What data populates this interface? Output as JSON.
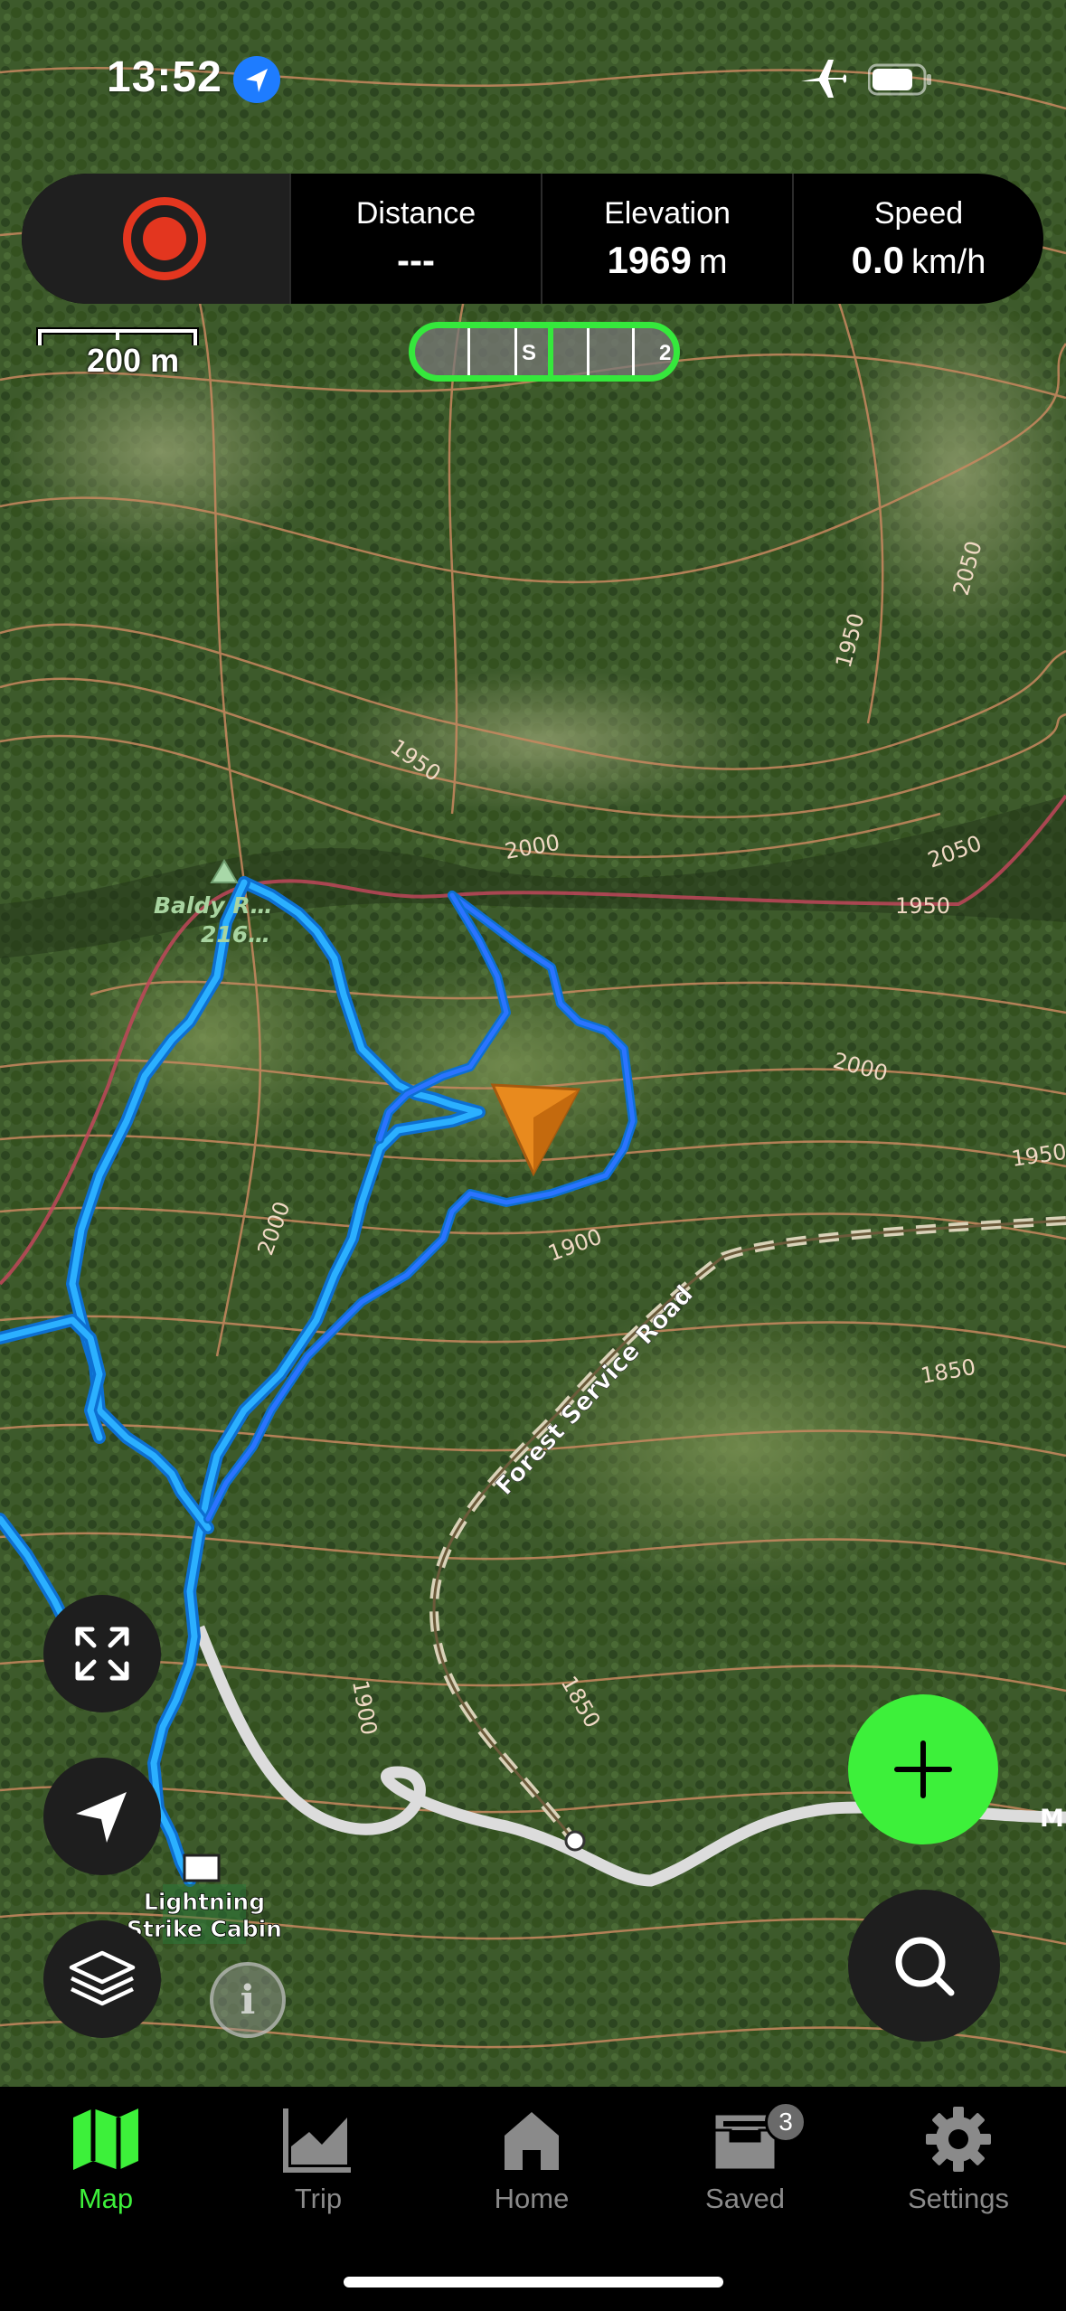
{
  "status_bar": {
    "time": "13:52",
    "location_icon": "location-arrow-icon",
    "airplane_icon": "airplane-icon",
    "battery_icon": "battery-icon"
  },
  "stats": {
    "record_icon": "record-icon",
    "distance": {
      "label": "Distance",
      "value": "---"
    },
    "elevation": {
      "label": "Elevation",
      "value": "1969",
      "unit": "m"
    },
    "speed": {
      "label": "Speed",
      "value": "0.0",
      "unit": "km/h"
    }
  },
  "scale": {
    "label": "200 m"
  },
  "compass": {
    "letter_s": "S",
    "letter_right": "2"
  },
  "map": {
    "peak_label": "Baldy R…",
    "peak_elev": "216…",
    "cabin_label_line1": "Lightning",
    "cabin_label_line2": "Strike Cabin",
    "road_label": "Forest Service Road",
    "road_end_label": "M",
    "contour_labels": [
      "1950",
      "1950",
      "2000",
      "2050",
      "2000",
      "1950",
      "2000",
      "1850",
      "1900",
      "1850",
      "2050",
      "1950",
      "1900"
    ],
    "colors": {
      "track": "#1aa0ff",
      "contour": "#c98860",
      "forest": "#3e5a2c",
      "user_marker": "#e88a1e"
    }
  },
  "controls": {
    "fullscreen_icon": "expand-icon",
    "locate_icon": "navigation-arrow-icon",
    "layers_icon": "layers-icon",
    "info_label": "i",
    "add_icon": "plus-icon",
    "search_icon": "search-icon"
  },
  "tabs": [
    {
      "label": "Map",
      "icon": "map-icon",
      "active": true
    },
    {
      "label": "Trip",
      "icon": "chart-icon",
      "active": false
    },
    {
      "label": "Home",
      "icon": "home-icon",
      "active": false
    },
    {
      "label": "Saved",
      "icon": "saved-icon",
      "badge": "3",
      "active": false
    },
    {
      "label": "Settings",
      "icon": "gear-icon",
      "active": false
    }
  ],
  "accent_color": "#3df03a"
}
